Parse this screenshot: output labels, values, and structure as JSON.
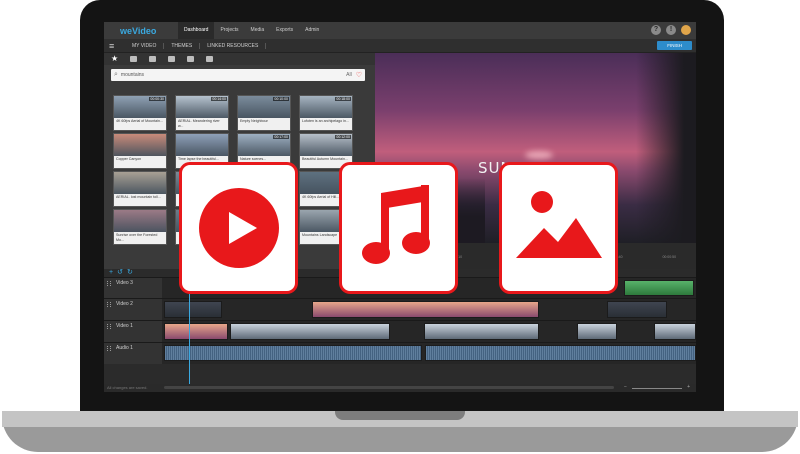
{
  "app": {
    "logo": "weVideo",
    "nav": [
      "Dashboard",
      "Projects",
      "Media",
      "Exports",
      "Admin"
    ],
    "active_nav": "Dashboard"
  },
  "subnav": {
    "items": [
      "MY VIDEO",
      "THEMES",
      "LINKED RESOURCES"
    ],
    "finish_label": "FINISH"
  },
  "media": {
    "search_value": "mountains",
    "filter_value": "All",
    "thumbnails": [
      {
        "duration": "00:00:30",
        "caption": "4K 60fps Aerial of Mountain..."
      },
      {
        "duration": "00:14:00",
        "caption": "AERIAL. Meandering river w..."
      },
      {
        "duration": "00:10:00",
        "caption": "Empty Neighbour"
      },
      {
        "duration": "00:18:00",
        "caption": "Lofoten is an archipelago in..."
      },
      {
        "duration": "",
        "caption": "Copper Canyon"
      },
      {
        "duration": "",
        "caption": "Time lapse the beautiful..."
      },
      {
        "duration": "00:17:00",
        "caption": "Nature scenes..."
      },
      {
        "duration": "00:12:00",
        "caption": "Beautiful Autumn Mountain..."
      },
      {
        "duration": "",
        "caption": "AERIAL. lost mountain toll..."
      },
      {
        "duration": "",
        "caption": ""
      },
      {
        "duration": "",
        "caption": ""
      },
      {
        "duration": "",
        "caption": "4K 60fps Aerial of Hill..."
      },
      {
        "duration": "",
        "caption": "Sunrise over the Forested Mo..."
      },
      {
        "duration": "",
        "caption": ""
      },
      {
        "duration": "",
        "caption": ""
      },
      {
        "duration": "",
        "caption": "Mountains Landscape"
      }
    ]
  },
  "preview": {
    "title": "SUMMER TRIP",
    "ruler": [
      "00:00:00",
      "00:00:10",
      "00:00:20",
      "00:00:30",
      "00:00:40",
      "00:00:50"
    ]
  },
  "timeline": {
    "tracks": [
      {
        "label": "Video 3"
      },
      {
        "label": "Video 2"
      },
      {
        "label": "Video 1"
      },
      {
        "label": "Audio 1"
      }
    ],
    "status": "All changes are saved."
  },
  "overlay": {
    "tiles": [
      "youtube-play",
      "music-note",
      "image-mountain"
    ],
    "accent": "#e8181b"
  }
}
